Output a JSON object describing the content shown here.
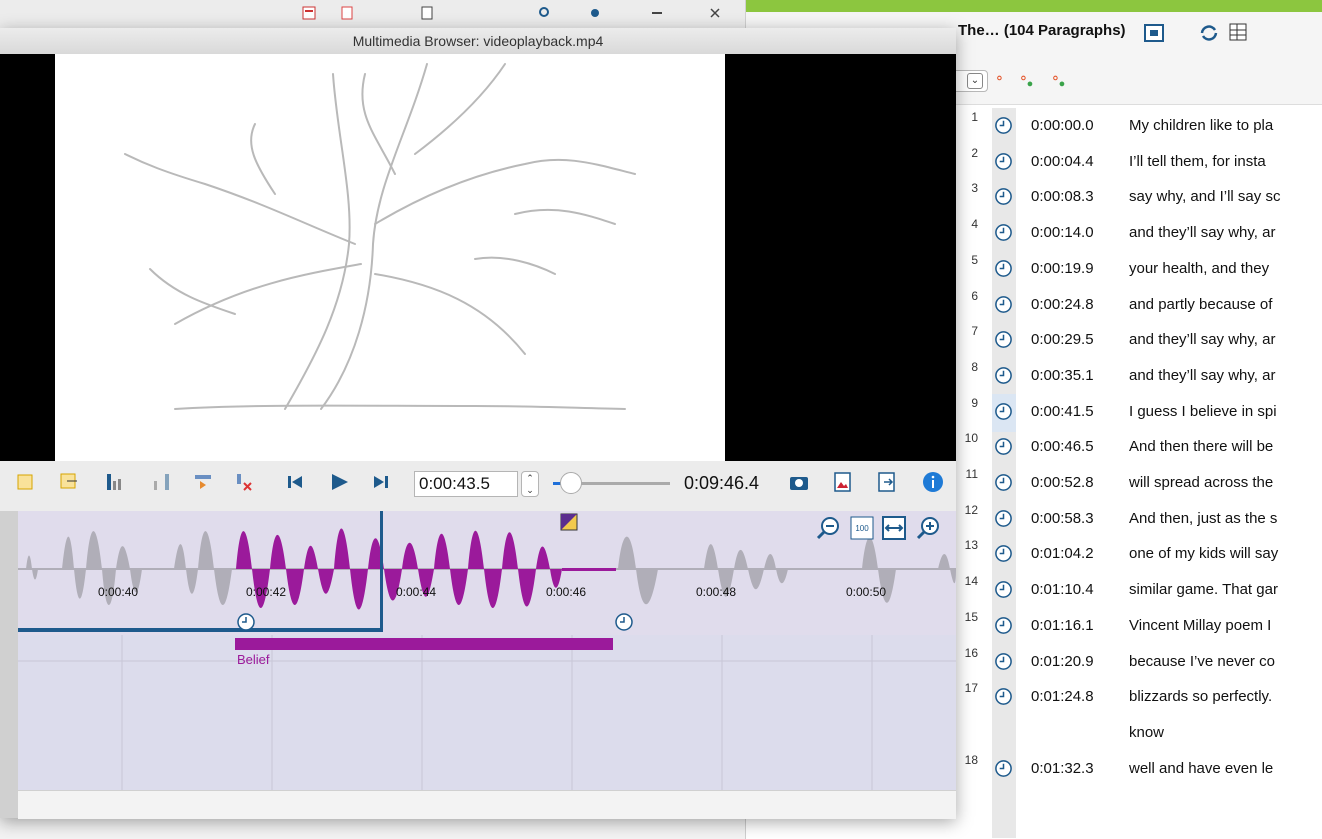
{
  "multimedia": {
    "window_title": "Multimedia Browser: videoplayback.mp4",
    "position": "0:00:43.5",
    "duration": "0:09:46.4",
    "slider_fraction": 0.074,
    "time_ticks": [
      "0:00:40",
      "0:00:42",
      "0:00:44",
      "0:00:46",
      "0:00:48",
      "0:00:50"
    ],
    "segment_label": "Belief",
    "colors": {
      "accent": "#1e5a8c",
      "segment": "#9b1a9b",
      "waveform_gray": "#b0aeb8"
    }
  },
  "document": {
    "title": "The…  (104 Paragraphs)",
    "rows": [
      {
        "num": "1",
        "time": "0:00:00.0",
        "text": "My children like to pla"
      },
      {
        "num": "2",
        "time": "0:00:04.4",
        "text": "I’ll tell them, for insta"
      },
      {
        "num": "3",
        "time": "0:00:08.3",
        "text": "say why, and I’ll say sc"
      },
      {
        "num": "4",
        "time": "0:00:14.0",
        "text": "and they’ll say why, ar"
      },
      {
        "num": "5",
        "time": "0:00:19.9",
        "text": "your health, and they"
      },
      {
        "num": "6",
        "time": "0:00:24.8",
        "text": "and partly because of"
      },
      {
        "num": "7",
        "time": "0:00:29.5",
        "text": "and they’ll say why, ar"
      },
      {
        "num": "8",
        "time": "0:00:35.1",
        "text": "and they’ll say why, ar"
      },
      {
        "num": "9",
        "time": "0:00:41.5",
        "text": "I guess I believe in spi"
      },
      {
        "num": "10",
        "time": "0:00:46.5",
        "text": "And then there will be"
      },
      {
        "num": "11",
        "time": "0:00:52.8",
        "text": "will spread across the"
      },
      {
        "num": "12",
        "time": "0:00:58.3",
        "text": "And then, just as the s"
      },
      {
        "num": "13",
        "time": "0:01:04.2",
        "text": "one of my kids will say"
      },
      {
        "num": "14",
        "time": "0:01:10.4",
        "text": "similar game. That gar"
      },
      {
        "num": "15",
        "time": "0:01:16.1",
        "text": "Vincent Millay poem I"
      },
      {
        "num": "16",
        "time": "0:01:20.9",
        "text": "because I’ve never co"
      },
      {
        "num": "17",
        "time": "0:01:24.8",
        "text": "blizzards so perfectly."
      },
      {
        "num": "",
        "time": "",
        "text": "know"
      },
      {
        "num": "18",
        "time": "0:01:32.3",
        "text": "well and have even le"
      }
    ],
    "selected_row": "9"
  }
}
